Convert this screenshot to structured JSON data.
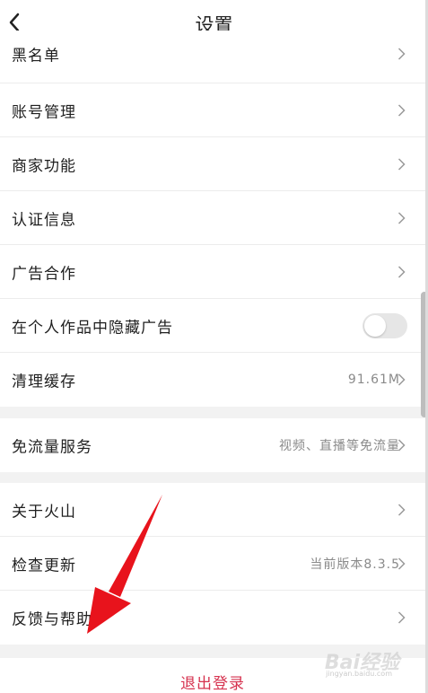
{
  "header": {
    "title": "设置",
    "back_icon": "chevron-left-icon"
  },
  "group1": [
    {
      "label": "黑名单"
    },
    {
      "label": "账号管理"
    },
    {
      "label": "商家功能"
    },
    {
      "label": "认证信息"
    },
    {
      "label": "广告合作"
    },
    {
      "label": "在个人作品中隐藏广告",
      "toggle": false
    },
    {
      "label": "清理缓存",
      "value": "91.61M"
    }
  ],
  "group2": [
    {
      "label": "免流量服务",
      "value": "视频、直播等免流量"
    }
  ],
  "group3": [
    {
      "label": "关于火山"
    },
    {
      "label": "检查更新",
      "value": "当前版本8.3.5"
    },
    {
      "label": "反馈与帮助"
    }
  ],
  "logout": {
    "label": "退出登录"
  },
  "watermark": {
    "text": "Bai经验",
    "sub": "jingyan.baidu.com"
  },
  "colors": {
    "accent": "#d6324f",
    "annotation_arrow": "#e8131c"
  }
}
